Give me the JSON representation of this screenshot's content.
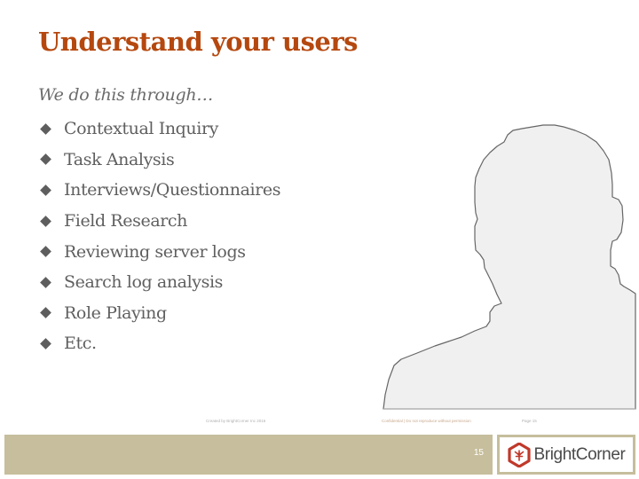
{
  "slide": {
    "title": "Understand your users",
    "intro": "We do this through…",
    "bullet_icon": "diamond-bullet-icon",
    "bullets": [
      {
        "label": "Contextual Inquiry"
      },
      {
        "label": "Task Analysis"
      },
      {
        "label": "Interviews/Questionnaires"
      },
      {
        "label": "Field Research"
      },
      {
        "label": "Reviewing server logs"
      },
      {
        "label": "Search log analysis"
      },
      {
        "label": "Role Playing"
      },
      {
        "label": "Etc."
      }
    ],
    "image": {
      "icon": "person-silhouette-icon",
      "fill_color": "#F0F0F0",
      "outline_color": "#666666"
    }
  },
  "footer": {
    "left_text": "Created by BrightCorner Inc 2016",
    "center_text": "Confidential | Do not reproduce without permission",
    "right_text": "Page 15",
    "page_number": "15",
    "logo_text": "BrightCorner",
    "logo_icon": "brightcorner-hexagon-logo-icon"
  },
  "colors": {
    "title": "#B5480F",
    "body_text": "#5F5F5F",
    "bar": "#C6BE9C",
    "logo_red": "#C0392B"
  }
}
